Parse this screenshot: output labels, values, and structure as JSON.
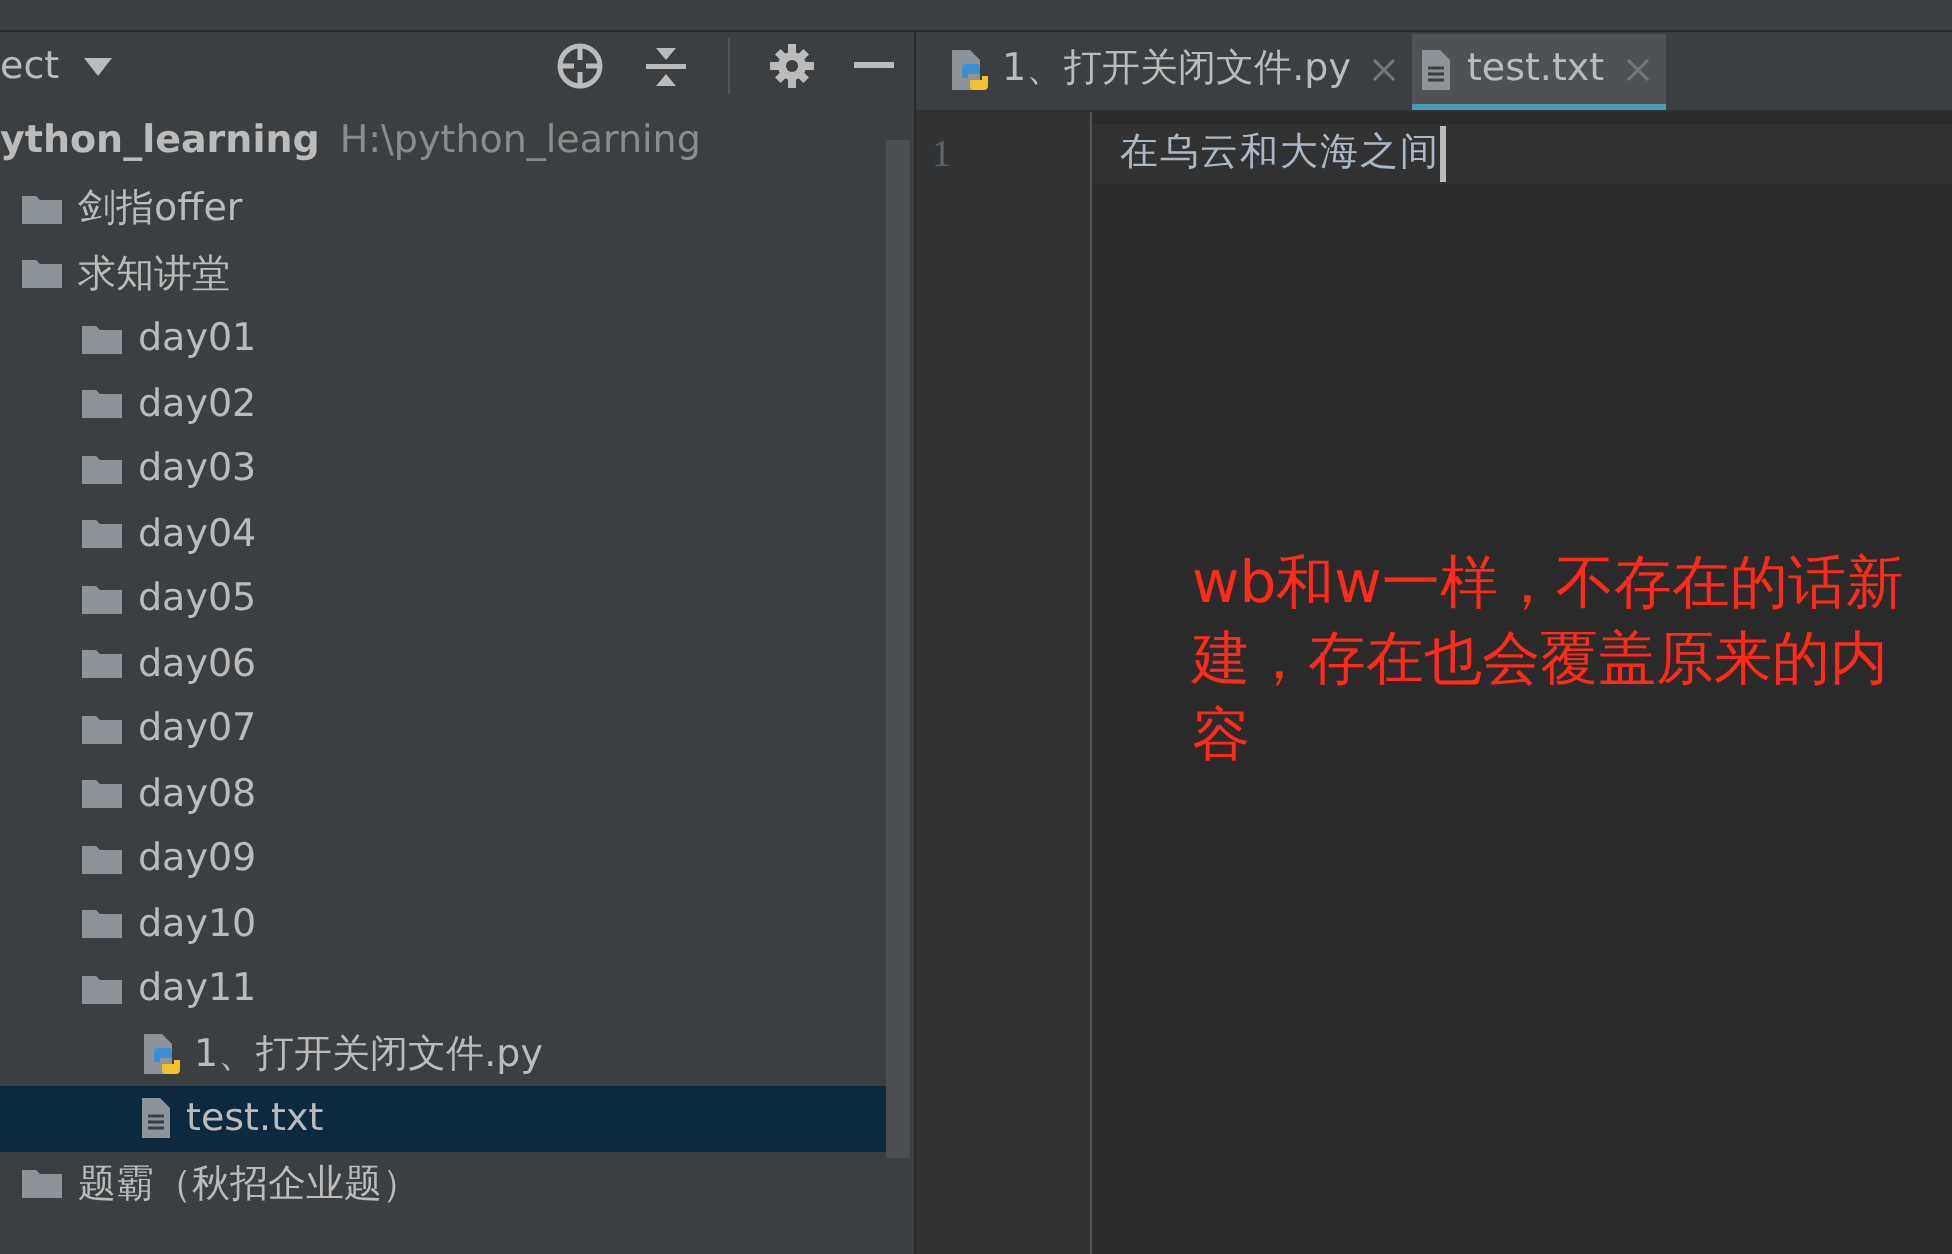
{
  "project_panel": {
    "title": "ect",
    "tree": {
      "name": "ython_learning",
      "path": "H:\\python_learning",
      "children": [
        {
          "name": "剑指offer",
          "kind": "folder",
          "selected": false
        },
        {
          "name": "求知讲堂",
          "kind": "folder",
          "selected": false,
          "children": [
            {
              "name": "day01",
              "kind": "folder",
              "selected": false
            },
            {
              "name": "day02",
              "kind": "folder",
              "selected": false
            },
            {
              "name": "day03",
              "kind": "folder",
              "selected": false
            },
            {
              "name": "day04",
              "kind": "folder",
              "selected": false
            },
            {
              "name": "day05",
              "kind": "folder",
              "selected": false
            },
            {
              "name": "day06",
              "kind": "folder",
              "selected": false
            },
            {
              "name": "day07",
              "kind": "folder",
              "selected": false
            },
            {
              "name": "day08",
              "kind": "folder",
              "selected": false
            },
            {
              "name": "day09",
              "kind": "folder",
              "selected": false
            },
            {
              "name": "day10",
              "kind": "folder",
              "selected": false
            },
            {
              "name": "day11",
              "kind": "folder",
              "selected": false,
              "children": [
                {
                  "name": "1、打开关闭文件.py",
                  "kind": "python",
                  "selected": false
                },
                {
                  "name": "test.txt",
                  "kind": "text",
                  "selected": true
                }
              ]
            }
          ]
        },
        {
          "name": "题霸（秋招企业题）",
          "kind": "folder",
          "selected": false
        }
      ]
    }
  },
  "editor": {
    "tabs": [
      {
        "label": "1、打开关闭文件.py",
        "kind": "python",
        "selected": false
      },
      {
        "label": "test.txt",
        "kind": "text",
        "selected": true
      }
    ],
    "lines": [
      {
        "number": "1",
        "text": "在乌云和大海之间"
      }
    ],
    "annotation": "wb和w一样，不存在的话新建，存在也会覆盖原来的内容"
  }
}
